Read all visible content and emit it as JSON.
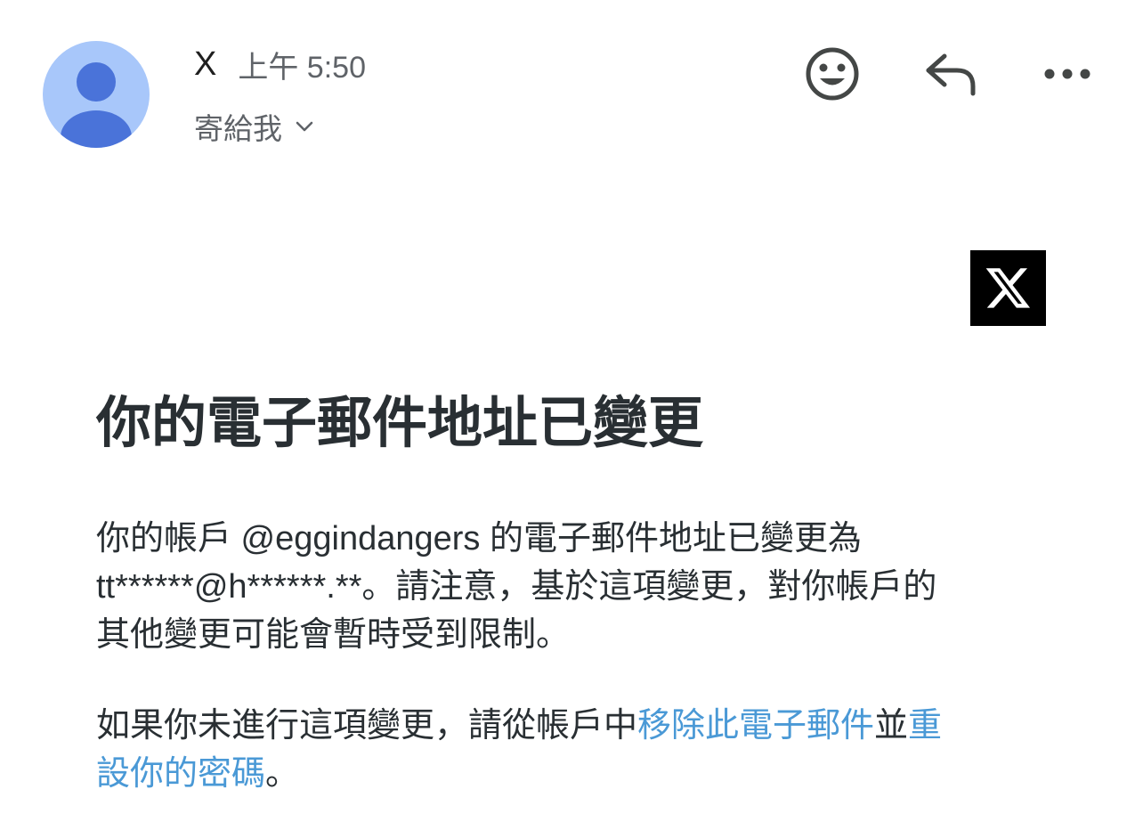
{
  "header": {
    "sender_name": "X",
    "time": "上午 5:50",
    "recipient_label": "寄給我",
    "icons": {
      "avatar": "default-person-avatar",
      "emoji": "emoji-reaction-icon",
      "reply": "reply-icon",
      "more": "more-options-icon",
      "chevron": "chevron-down-icon"
    }
  },
  "email": {
    "logo": "X",
    "title": "你的電子郵件地址已變更",
    "paragraph1": {
      "line1": "你的帳戶 @eggindangers 的電子郵件地址已變更為",
      "line2": "tt******@h******.**。請注意，基於這項變更，對你帳戶的",
      "line3": "其他變更可能會暫時受到限制。"
    },
    "paragraph2": {
      "text_before": "如果你未進行這項變更，請從帳戶中",
      "link_remove_email": "移除此電子郵件",
      "text_middle": "並",
      "link_reset_part1": "重",
      "link_reset_part2": "設你的密碼",
      "text_end": "。"
    }
  },
  "colors": {
    "avatar_bg": "#a8c7fa",
    "avatar_figure": "#4a73d9",
    "link": "#4a99d6",
    "title_text": "#292f33",
    "meta_text": "#5f6368",
    "logo_bg": "#000000"
  }
}
